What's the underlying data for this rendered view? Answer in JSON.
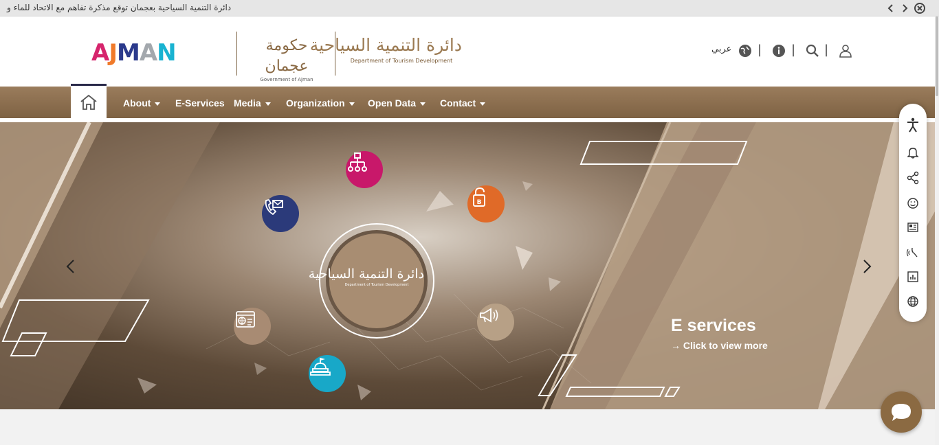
{
  "ticker": {
    "text": "دائرة التنمية السياحية بعجمان توقع مذكرة تفاهم مع الاتحاد للماء و",
    "prev_icon": "chevron-left-icon",
    "next_icon": "chevron-right-icon",
    "close_icon": "close-circle-icon"
  },
  "header": {
    "brand_letters": [
      "A",
      "J",
      "M",
      "A",
      "N"
    ],
    "brand_colors": [
      "#d6256d",
      "#f07a2a",
      "#2b3a8c",
      "#a3a8ad",
      "#19b3d1"
    ],
    "gov_logo_ar": "حكومة عجمان",
    "gov_logo_en": "Government of Ajman",
    "dtd_logo_ar": "دائرة التنمية السياحية",
    "dtd_logo_en": "Department of Tourism Development",
    "language_label": "عربي",
    "language_icon": "globe-icon",
    "info_icon": "info-icon",
    "search_icon": "search-icon",
    "user_icon": "user-icon"
  },
  "nav": {
    "home_icon": "home-icon",
    "items": [
      {
        "label": "About",
        "dropdown": true
      },
      {
        "label": "E-Services",
        "dropdown": false
      },
      {
        "label": "Media",
        "dropdown": true
      },
      {
        "label": "Organization",
        "dropdown": true
      },
      {
        "label": "Open Data",
        "dropdown": true
      },
      {
        "label": "Contact",
        "dropdown": true
      }
    ]
  },
  "hero": {
    "title": "E services",
    "link_label": "Click to view more",
    "center_logo_ar": "دائرة التنمية السياحية",
    "center_logo_en": "Department of Tourism Development",
    "icons": [
      {
        "name": "org-chart-icon",
        "color": "#c8186a"
      },
      {
        "name": "contact-icon",
        "color": "#2b3a7a"
      },
      {
        "name": "unlock-icon",
        "color": "#e06a28"
      },
      {
        "name": "web-form-icon",
        "color": "#a88b73"
      },
      {
        "name": "megaphone-icon",
        "color": "#b7a086"
      },
      {
        "name": "landmark-icon",
        "color": "#18a8c8"
      }
    ]
  },
  "accessibility": {
    "items": [
      "accessibility-icon",
      "bell-icon",
      "share-icon",
      "smile-icon",
      "news-icon",
      "sign-language-icon",
      "stats-icon",
      "globe-icon"
    ]
  },
  "chat": {
    "icon": "chat-bubble-icon"
  }
}
